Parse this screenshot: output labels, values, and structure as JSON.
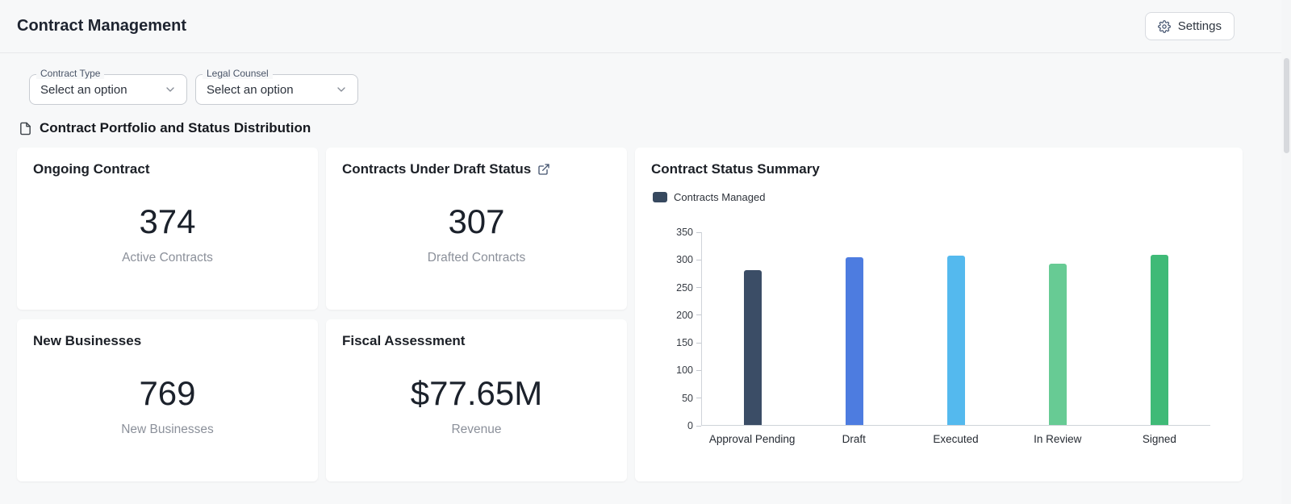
{
  "header": {
    "title": "Contract Management",
    "settings_label": "Settings"
  },
  "filters": [
    {
      "label": "Contract Type",
      "value": "Select an option"
    },
    {
      "label": "Legal Counsel",
      "value": "Select an option"
    }
  ],
  "section": {
    "title": "Contract Portfolio and Status Distribution"
  },
  "cards": [
    {
      "title": "Ongoing Contract",
      "value": "374",
      "subtitle": "Active Contracts"
    },
    {
      "title": "Contracts Under Draft Status",
      "value": "307",
      "subtitle": "Drafted Contracts"
    },
    {
      "title": "New Businesses",
      "value": "769",
      "subtitle": "New Businesses"
    },
    {
      "title": "Fiscal Assessment",
      "value": "$77.65M",
      "subtitle": "Revenue"
    }
  ],
  "chart_card": {
    "title": "Contract Status Summary",
    "legend": "Contracts Managed",
    "legend_color": "#37495f"
  },
  "chart_data": {
    "type": "bar",
    "title": "Contract Status Summary",
    "categories": [
      "Approval Pending",
      "Draft",
      "Executed",
      "In Review",
      "Signed"
    ],
    "series": [
      {
        "name": "Contracts Managed",
        "values": [
          280,
          303,
          306,
          292,
          308
        ]
      }
    ],
    "bar_colors": [
      "#3b4d66",
      "#4d7ce0",
      "#54b9ee",
      "#67cb94",
      "#3fba77"
    ],
    "xlabel": "",
    "ylabel": "",
    "ylim": [
      0,
      350
    ],
    "yticks": [
      0,
      50,
      100,
      150,
      200,
      250,
      300,
      350
    ],
    "grid": false,
    "legend_position": "top-left"
  }
}
